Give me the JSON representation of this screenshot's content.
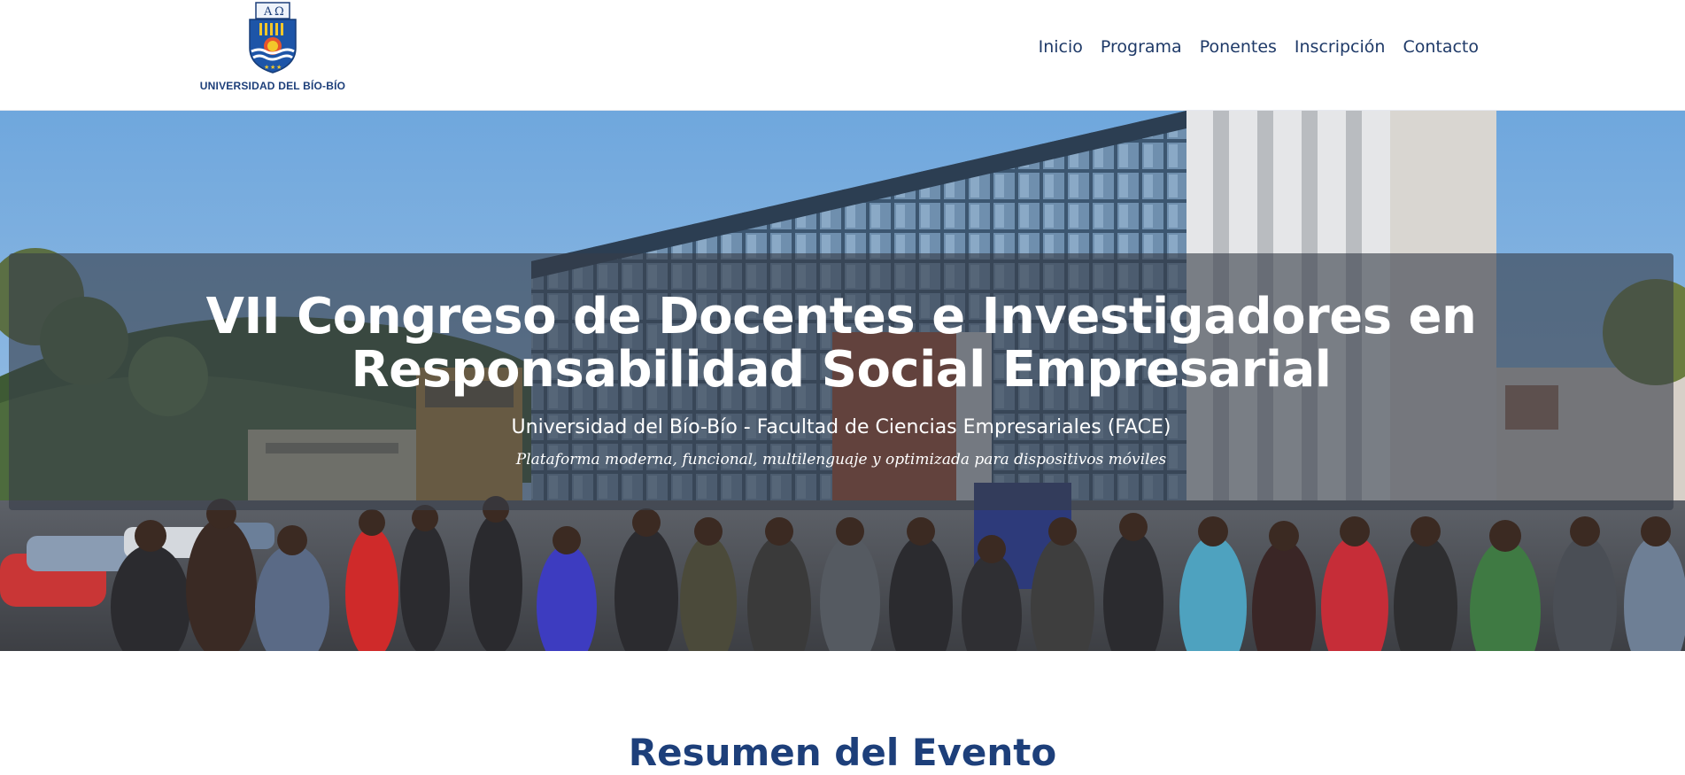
{
  "header": {
    "logo_text": "UNIVERSIDAD DEL BÍO-BÍO",
    "nav": [
      {
        "label": "Inicio"
      },
      {
        "label": "Programa"
      },
      {
        "label": "Ponentes"
      },
      {
        "label": "Inscripción"
      },
      {
        "label": "Contacto"
      }
    ]
  },
  "hero": {
    "title": "VII Congreso de Docentes e Investigadores en Responsabilidad Social Empresarial",
    "subtitle": "Universidad del Bío-Bío - Facultad de Ciencias Empresariales (FACE)",
    "tagline": "Plataforma moderna, funcional, multilenguaje y optimizada para dispositivos móviles"
  },
  "section": {
    "heading": "Resumen del Evento"
  },
  "colors": {
    "brand": "#1d3f7a",
    "nav_text": "#1f3a68",
    "overlay": "rgba(55,62,72,0.62)"
  },
  "icons": {
    "logo": "university-crest-icon"
  }
}
